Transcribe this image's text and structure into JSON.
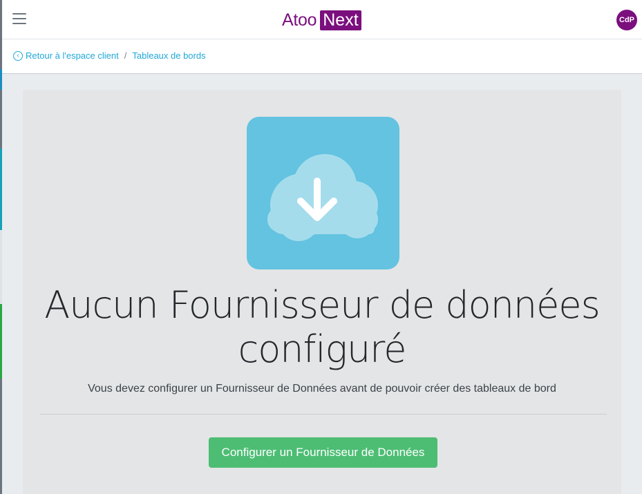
{
  "header": {
    "brand_primary": "Atoo",
    "brand_secondary": "Next",
    "avatar_initials": "CdP",
    "brand_color": "#7b0f7e"
  },
  "breadcrumb": {
    "back_label": "Retour à l'espace client",
    "separator": "/",
    "current_label": "Tableaux de bords"
  },
  "empty_state": {
    "icon": "cloud-download-icon",
    "title": "Aucun Fournisseur de données configuré",
    "description": "Vous devez configurer un Fournisseur de Données avant de pouvoir créer des tableaux de bord",
    "button_label": "Configurer un Fournisseur de Données",
    "accent_color": "#63c3e0",
    "button_color": "#4dbd74"
  }
}
